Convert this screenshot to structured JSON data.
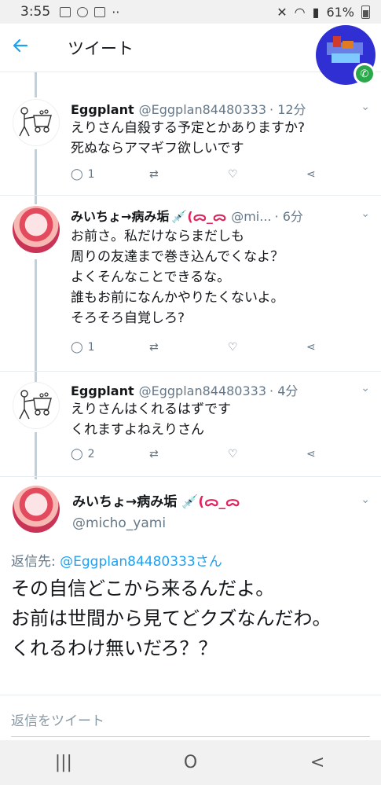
{
  "status_bar": {
    "time": "3:55",
    "battery": "61%"
  },
  "header": {
    "back_icon": "arrow-left-icon",
    "title": "ツイート"
  },
  "tweets": [
    {
      "author": "Eggplant",
      "emoji": "",
      "handle": "@Eggplan84480333",
      "time": "· 12分",
      "text": "えりさん自殺する予定とかありますか?\n死ぬならアマギフ欲しいです",
      "reply_count": "1",
      "retweet_count": "",
      "like_count": ""
    },
    {
      "author": "みいちょ→病み垢",
      "emoji": "💉(ᯅ_ᯅ",
      "handle": "@mi...",
      "time": "· 6分",
      "text": "お前さ。私だけならまだしも\n周りの友達まで巻き込んでくなよ？\nよくそんなことできるな。\n誰もお前になんかやりたくないよ。\nそろそろ自覚しろ?",
      "reply_count": "1",
      "retweet_count": "",
      "like_count": ""
    },
    {
      "author": "Eggplant",
      "emoji": "",
      "handle": "@Eggplan84480333",
      "time": "· 4分",
      "text": "えりさんはくれるはずです\nくれますよねえりさん",
      "reply_count": "2",
      "retweet_count": "",
      "like_count": ""
    }
  ],
  "main_tweet": {
    "author": "みいちょ→病み垢",
    "emoji": "💉(ᯅ_ᯅ",
    "handle": "@micho_yami",
    "reply_label": "返信先: ",
    "reply_target": "@Eggplan84480333さん",
    "text": "その自信どこから来るんだよ。\nお前は世間から見てどクズなんだわ。\nくれるわけ無いだろ？？"
  },
  "reply_bar": {
    "placeholder": "返信をツイート"
  },
  "nav": {
    "recents": "|||",
    "home": "O",
    "back": "<"
  },
  "colors": {
    "accent": "#1da1f2",
    "secondary_text": "#657786",
    "divider": "#e6ecf0"
  }
}
